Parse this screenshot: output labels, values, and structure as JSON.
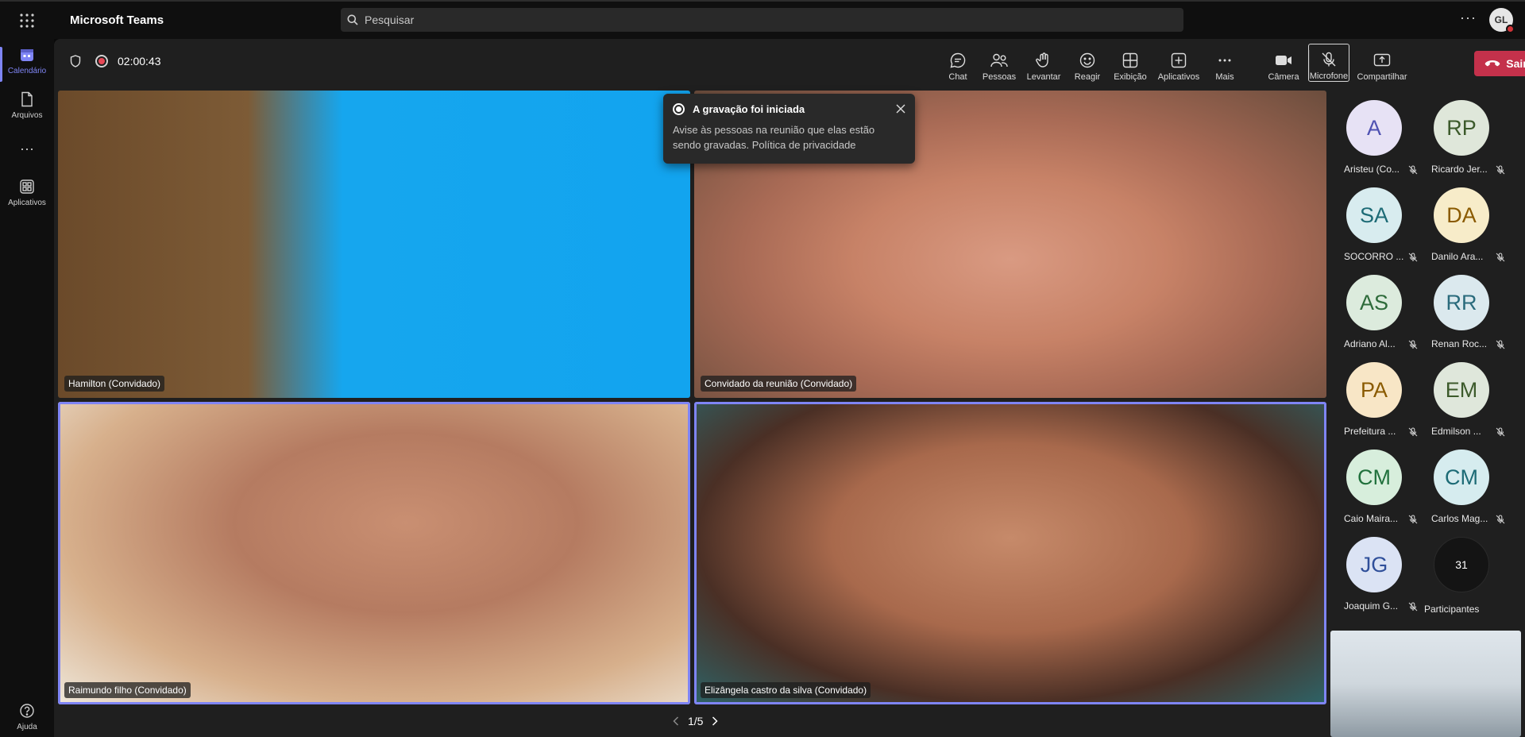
{
  "app": {
    "title": "Microsoft Teams"
  },
  "search": {
    "placeholder": "Pesquisar"
  },
  "profile": {
    "initials": "GL"
  },
  "rail": {
    "items": [
      {
        "label": "Calendário",
        "icon": "calendar-icon",
        "active": true
      },
      {
        "label": "Arquivos",
        "icon": "file-icon"
      },
      {
        "label": "Aplicativos",
        "icon": "apps-icon"
      },
      {
        "label": "Ajuda",
        "icon": "help-icon"
      }
    ]
  },
  "meeting": {
    "timer": "02:00:43",
    "tools": [
      {
        "label": "Chat",
        "icon": "chat-icon"
      },
      {
        "label": "Pessoas",
        "icon": "people-icon"
      },
      {
        "label": "Levantar",
        "icon": "raise-hand-icon"
      },
      {
        "label": "Reagir",
        "icon": "react-icon"
      },
      {
        "label": "Exibição",
        "icon": "view-icon"
      },
      {
        "label": "Aplicativos",
        "icon": "apps-add-icon"
      },
      {
        "label": "Mais",
        "icon": "more-icon"
      },
      {
        "label": "Câmera",
        "icon": "camera-icon"
      },
      {
        "label": "Microfone",
        "icon": "mic-off-icon"
      },
      {
        "label": "Compartilhar",
        "icon": "share-icon"
      }
    ],
    "leave_label": "Sair"
  },
  "toast": {
    "title": "A gravação foi iniciada",
    "body": "Avise às pessoas na reunião que elas estão sendo gravadas. Política de privacidade"
  },
  "tiles": [
    {
      "name": "Hamilton (Convidado)"
    },
    {
      "name": "Convidado da reunião (Convidado)"
    },
    {
      "name": "Raimundo filho (Convidado)"
    },
    {
      "name": "Elizângela castro da silva (Convidado)"
    }
  ],
  "pager": {
    "label": "1/5"
  },
  "roster": [
    {
      "initials": "A",
      "name": "Aristeu (Co...",
      "bg": "#e7e2f5",
      "fg": "#4f52b2"
    },
    {
      "initials": "RP",
      "name": "Ricardo Jer...",
      "bg": "#dfe7da",
      "fg": "#3c5a2b"
    },
    {
      "initials": "SA",
      "name": "SOCORRO ...",
      "bg": "#d8ecef",
      "fg": "#1d6b76"
    },
    {
      "initials": "DA",
      "name": "Danilo Ara...",
      "bg": "#f7ecc9",
      "fg": "#8a5a00"
    },
    {
      "initials": "AS",
      "name": "Adriano Al...",
      "bg": "#dcebdd",
      "fg": "#2e6b3a"
    },
    {
      "initials": "RR",
      "name": "Renan Roc...",
      "bg": "#dbe9ee",
      "fg": "#2a6b7c"
    },
    {
      "initials": "PA",
      "name": "Prefeitura ...",
      "bg": "#f8e6c6",
      "fg": "#8a5a00"
    },
    {
      "initials": "EM",
      "name": "Edmilson ...",
      "bg": "#dfe7db",
      "fg": "#3c5a2b"
    },
    {
      "initials": "CM",
      "name": "Caio Maira...",
      "bg": "#d7eedc",
      "fg": "#21713d"
    },
    {
      "initials": "CM",
      "name": "Carlos Mag...",
      "bg": "#d6ecef",
      "fg": "#1d6b76"
    },
    {
      "initials": "JG",
      "name": "Joaquim G...",
      "bg": "#dbe3f4",
      "fg": "#2f4f9a"
    }
  ],
  "participants": {
    "count": "31",
    "label": "Participantes"
  }
}
